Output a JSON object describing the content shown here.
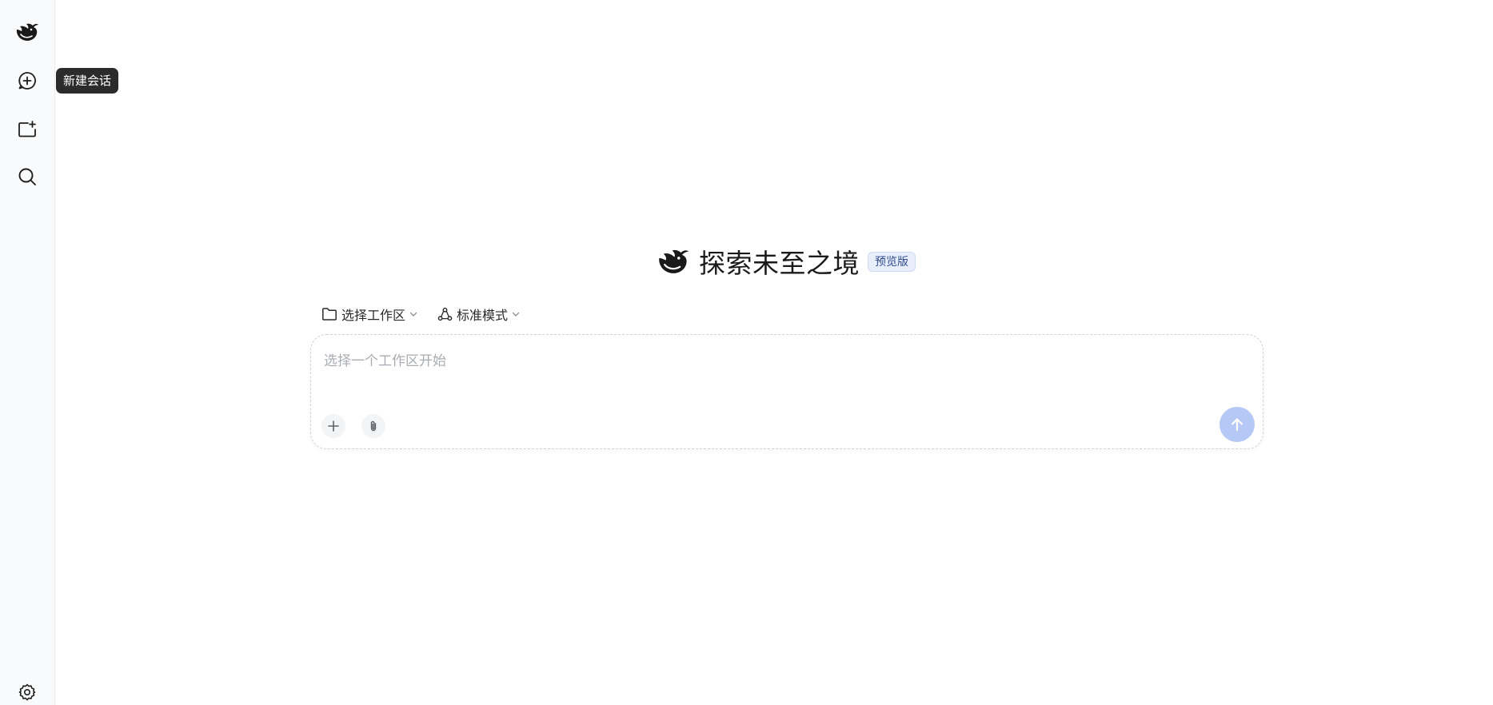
{
  "sidebar": {
    "items": [
      {
        "icon": "whale-logo-icon"
      },
      {
        "icon": "new-chat-icon",
        "tooltip": "新建会话"
      },
      {
        "icon": "new-folder-icon"
      },
      {
        "icon": "search-icon"
      },
      {
        "icon": "gear-icon"
      }
    ]
  },
  "hero": {
    "title": "探索未至之境",
    "badge": "预览版"
  },
  "selectors": {
    "workspace_label": "选择工作区",
    "mode_label": "标准模式"
  },
  "composer": {
    "placeholder": "选择一个工作区开始"
  },
  "colors": {
    "brand_blue": "#b5c8f6",
    "badge_bg": "#e8eefc",
    "badge_text": "#2f4d8f",
    "tooltip_bg": "#2b2b2b"
  }
}
